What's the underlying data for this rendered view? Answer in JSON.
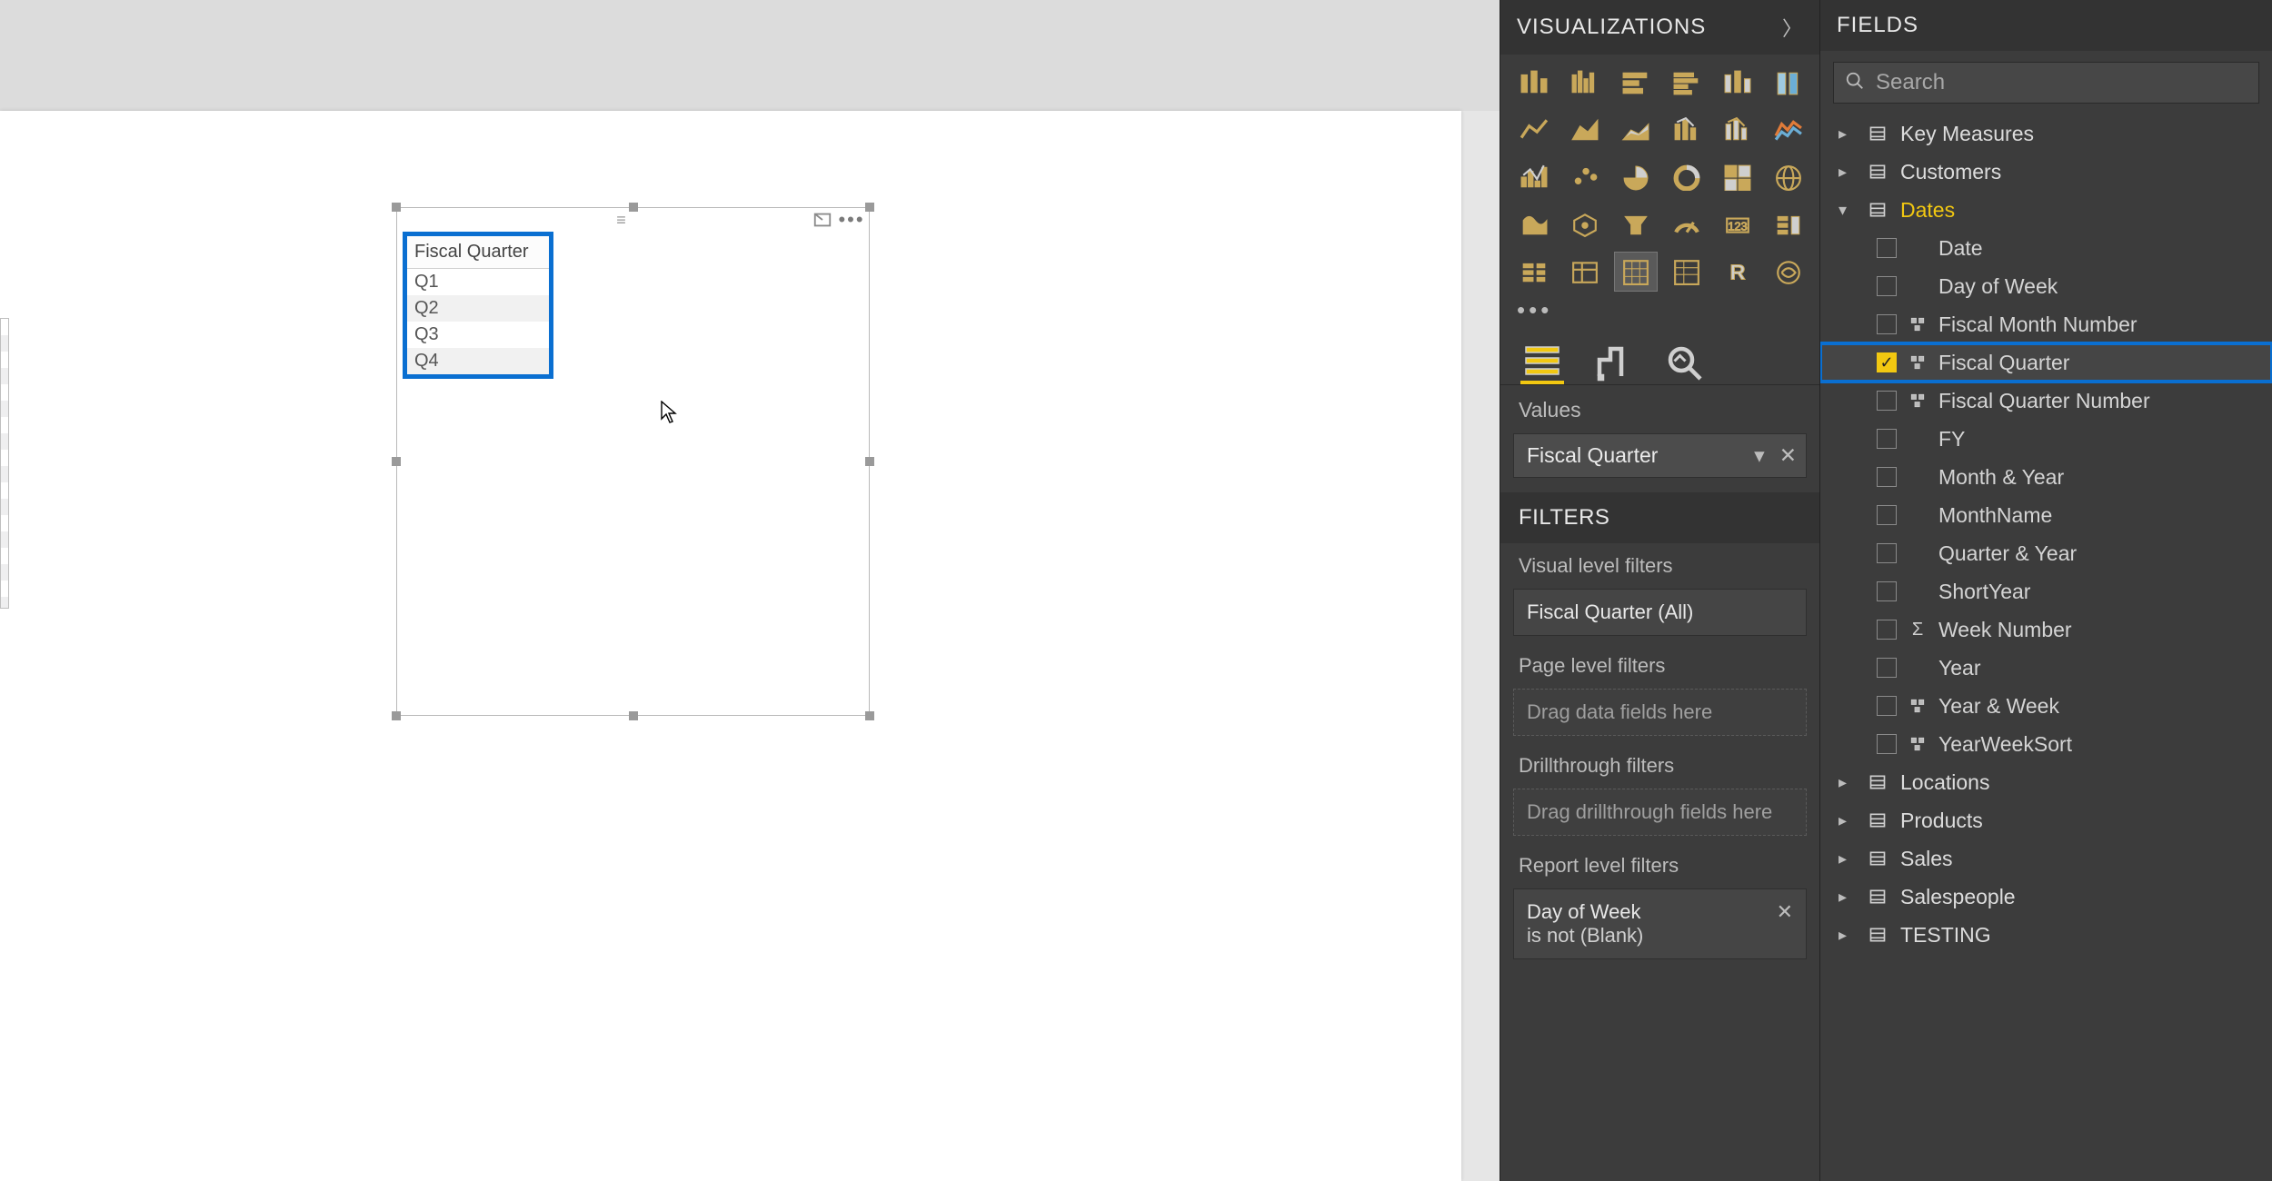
{
  "canvas": {
    "visual": {
      "column_header": "Fiscal Quarter",
      "rows": [
        "Q1",
        "Q2",
        "Q3",
        "Q4"
      ]
    }
  },
  "visualizations_pane": {
    "title": "VISUALIZATIONS",
    "tabs": {
      "fields": "Fields",
      "format": "Format",
      "analytics": "Analytics"
    },
    "values_label": "Values",
    "values_field": "Fiscal Quarter",
    "filters_title": "FILTERS",
    "visual_filters_label": "Visual level filters",
    "visual_filter_card": "Fiscal Quarter (All)",
    "page_filters_label": "Page level filters",
    "page_drop_hint": "Drag data fields here",
    "drill_filters_label": "Drillthrough filters",
    "drill_drop_hint": "Drag drillthrough fields here",
    "report_filters_label": "Report level filters",
    "report_filter_line1": "Day of Week",
    "report_filter_line2": "is not (Blank)"
  },
  "fields_pane": {
    "title": "FIELDS",
    "search_placeholder": "Search",
    "tables": [
      {
        "name": "Key Measures",
        "expanded": false
      },
      {
        "name": "Customers",
        "expanded": false
      },
      {
        "name": "Dates",
        "expanded": true,
        "fields": [
          {
            "name": "Date",
            "checked": false,
            "icon": "none"
          },
          {
            "name": "Day of Week",
            "checked": false,
            "icon": "none"
          },
          {
            "name": "Fiscal Month Number",
            "checked": false,
            "icon": "hier"
          },
          {
            "name": "Fiscal Quarter",
            "checked": true,
            "icon": "hier",
            "highlighted": true
          },
          {
            "name": "Fiscal Quarter Number",
            "checked": false,
            "icon": "hier"
          },
          {
            "name": "FY",
            "checked": false,
            "icon": "none"
          },
          {
            "name": "Month & Year",
            "checked": false,
            "icon": "none"
          },
          {
            "name": "MonthName",
            "checked": false,
            "icon": "none"
          },
          {
            "name": "Quarter & Year",
            "checked": false,
            "icon": "none"
          },
          {
            "name": "ShortYear",
            "checked": false,
            "icon": "none"
          },
          {
            "name": "Week Number",
            "checked": false,
            "icon": "sigma"
          },
          {
            "name": "Year",
            "checked": false,
            "icon": "none"
          },
          {
            "name": "Year & Week",
            "checked": false,
            "icon": "hier"
          },
          {
            "name": "YearWeekSort",
            "checked": false,
            "icon": "hier"
          }
        ]
      },
      {
        "name": "Locations",
        "expanded": false
      },
      {
        "name": "Products",
        "expanded": false
      },
      {
        "name": "Sales",
        "expanded": false
      },
      {
        "name": "Salespeople",
        "expanded": false
      },
      {
        "name": "TESTING",
        "expanded": false
      }
    ]
  }
}
